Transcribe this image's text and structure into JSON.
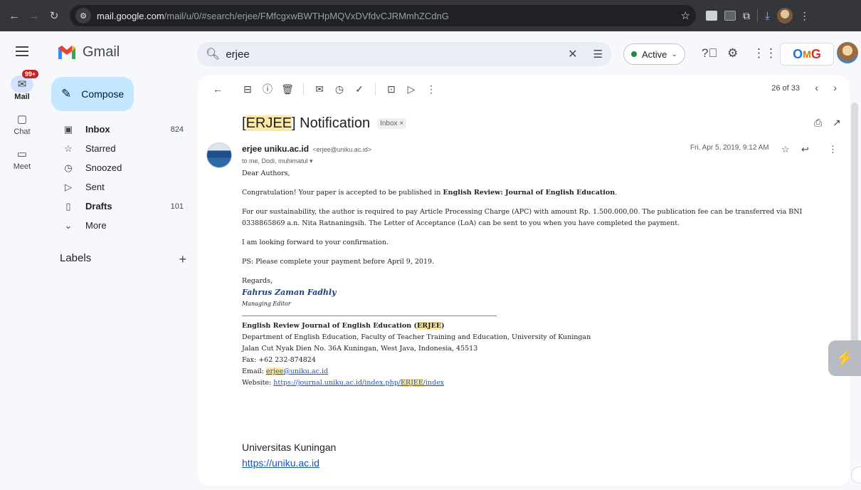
{
  "browser": {
    "url_host": "mail.google.com",
    "url_path": "/mail/u/0/#search/erjee/FMfcgxwBWTHpMQVxDVfdvCJRMmhZCdnG"
  },
  "header": {
    "app_name": "Gmail",
    "search_value": "erjee",
    "status": "Active"
  },
  "rail": {
    "mail_label": "Mail",
    "mail_badge": "99+",
    "chat_label": "Chat",
    "meet_label": "Meet"
  },
  "nav": {
    "compose_label": "Compose",
    "items": [
      {
        "label": "Inbox",
        "count": "824",
        "icon": "inbox-icon"
      },
      {
        "label": "Starred",
        "count": "",
        "icon": "star-icon"
      },
      {
        "label": "Snoozed",
        "count": "",
        "icon": "clock-icon"
      },
      {
        "label": "Sent",
        "count": "",
        "icon": "send-icon"
      },
      {
        "label": "Drafts",
        "count": "101",
        "icon": "draft-icon"
      },
      {
        "label": "More",
        "count": "",
        "icon": "chevron-down-icon"
      }
    ],
    "labels_title": "Labels"
  },
  "mail": {
    "pager": "26 of 33",
    "subject_prefix": "[",
    "subject_highlight": "ERJEE",
    "subject_suffix": "] Notification",
    "inbox_chip": "Inbox ×",
    "sender_name": "erjee uniku.ac.id",
    "sender_email": "<erjee@uniku.ac.id>",
    "recipients": "to me, Dodi, muhimatul",
    "date": "Fri, Apr 5, 2019, 9:12 AM",
    "greeting": "Dear Authors,",
    "para1_start": "Congratulation! Your paper is accepted to be published in ",
    "para1_bold": "English Review: Journal of English Education",
    "para1_end": ".",
    "para2": "For our sustainability, the author is required to pay Article Processing Charge (APC) with amount Rp. 1.500.000,00. The publication fee can be transferred via BNI 0338865869 a.n. Nita Ratnaningsih. The Letter of Acceptance (LoA) can be sent to you when you have completed the payment.",
    "para3": "I am looking forward to your confirmation.",
    "para4": "PS: Please complete your payment before April 9, 2019.",
    "regards": "Regards,",
    "sig_name": "Fahrus Zaman Fadhly",
    "sig_role": "Managing Editor",
    "org_name_start": "English Review Journal of English Education (",
    "org_name_hl": "ERJEE",
    "org_name_end": ")",
    "org_dept": "Department of English Education, Faculty of Teacher Training and Education, University of Kuningan",
    "org_address": "Jalan Cut Nyak Dien No. 36A Kuningan, West Java, Indonesia, 45513",
    "org_fax": "Fax: +62 232-874824",
    "email_label": "Email: ",
    "email_hl": "erjee",
    "email_rest": "@uniku.ac.id",
    "website_label": "Website: ",
    "website_start": "https://journal.uniku.ac.id/index.php/",
    "website_hl": "ERJEE",
    "website_end": "/index",
    "footer_name": "Universitas Kuningan",
    "footer_link": "https://uniku.ac.id"
  }
}
